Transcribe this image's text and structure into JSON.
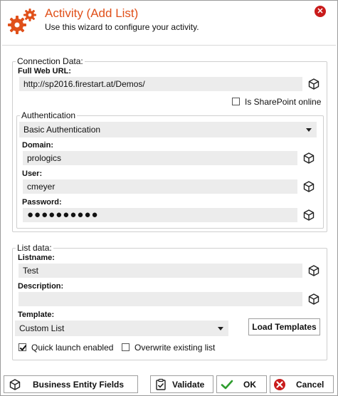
{
  "header": {
    "title": "Activity (Add List)",
    "subtitle": "Use this wizard to configure your activity.",
    "accent_color": "#e0501a"
  },
  "connection": {
    "group_label": "Connection Data:",
    "url_label": "Full Web URL:",
    "url_value": "http://sp2016.firestart.at/Demos/",
    "sharepoint_online_label": "Is SharePoint online",
    "sharepoint_online_checked": false,
    "auth": {
      "group_label": "Authentication",
      "method": "Basic Authentication",
      "domain_label": "Domain:",
      "domain_value": "prologics",
      "user_label": "User:",
      "user_value": "cmeyer",
      "password_label": "Password:",
      "password_value": "●●●●●●●●●●"
    }
  },
  "list": {
    "group_label": "List data:",
    "listname_label": "Listname:",
    "listname_value": "Test",
    "description_label": "Description:",
    "description_value": "",
    "template_label": "Template:",
    "template_value": "Custom List",
    "load_templates_label": "Load Templates",
    "quick_launch_label": "Quick launch enabled",
    "quick_launch_checked": true,
    "overwrite_label": "Overwrite existing list",
    "overwrite_checked": false
  },
  "footer": {
    "business_entity_label": "Business Entity Fields",
    "validate_label": "Validate",
    "ok_label": "OK",
    "cancel_label": "Cancel"
  },
  "icons": {
    "header": "gears-icon",
    "close": "close-icon",
    "field_helper": "cube-icon",
    "validate": "clipboard-check-icon",
    "ok": "checkmark-icon",
    "cancel": "cancel-icon"
  }
}
